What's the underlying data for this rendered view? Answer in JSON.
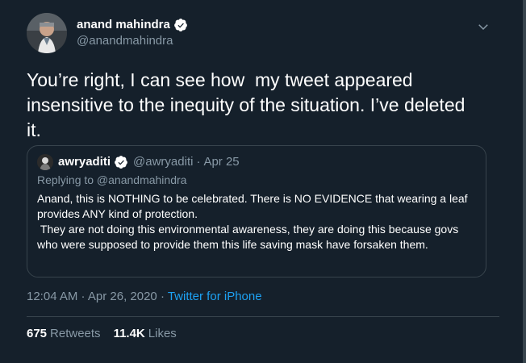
{
  "author": {
    "name": "anand mahindra",
    "handle": "@anandmahindra"
  },
  "tweet": {
    "text": "You’re right, I can see how  my tweet appeared insensitive to the inequity of the situation. I’ve deleted it."
  },
  "quote": {
    "name": "awryaditi",
    "handle": "@awryaditi",
    "dot": "·",
    "date": "Apr 25",
    "replying": "Replying to @anandmahindra",
    "body": "Anand, this is NOTHING to be celebrated. There is NO EVIDENCE that wearing a leaf provides ANY kind of protection.\n They are not doing this environmental awareness, they are doing this because govs who were supposed to provide them this life saving mask have forsaken them."
  },
  "meta": {
    "timestamp": "12:04 AM · Apr 26, 2020",
    "sep": " · ",
    "source": "Twitter for iPhone"
  },
  "stats": {
    "retweets_count": "675",
    "retweets_label": "Retweets",
    "likes_count": "11.4K",
    "likes_label": "Likes"
  },
  "icons": {
    "verified": "verified-badge-icon",
    "more": "chevron-down-icon"
  },
  "colors": {
    "background": "#15202b",
    "secondary_text": "#8899a6",
    "link": "#1da1f2",
    "border": "#38444d"
  }
}
